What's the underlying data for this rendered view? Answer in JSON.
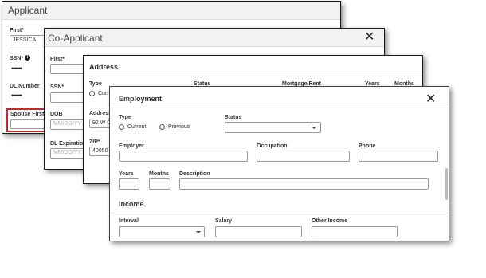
{
  "applicant": {
    "title": "Applicant",
    "first_label": "First*",
    "first_value": "JESSICA",
    "ssn_label": "SSN*",
    "ssn_dots": "••••••",
    "dl_number_label": "DL Number",
    "dl_dots": "••••••",
    "spouse_first_label": "Spouse First"
  },
  "coapplicant": {
    "title": "Co-Applicant",
    "first_label": "First*",
    "ssn_label": "SSN*",
    "dob_label": "DOB",
    "dob_placeholder": "MM/DD/YY",
    "dl_expiration_label": "DL Expiration",
    "dl_expiration_placeholder": "MM/DD/YY"
  },
  "address": {
    "title": "Address",
    "type_label": "Type",
    "type_option_current": "Curr",
    "status_label": "Status",
    "mortgage_label": "Mortgage/Rent",
    "years_label": "Years",
    "months_label": "Months",
    "address_label": "Address",
    "address_value": "92 W G",
    "zip_label": "ZIP*",
    "zip_value": "40050"
  },
  "employment": {
    "title": "Employment",
    "type_label": "Type",
    "type_options": [
      "Current",
      "Previous"
    ],
    "status_label": "Status",
    "employer_label": "Employer",
    "occupation_label": "Occupation",
    "phone_label": "Phone",
    "years_label": "Years",
    "months_label": "Months",
    "description_label": "Description",
    "income_heading": "Income",
    "interval_label": "Interval",
    "salary_label": "Salary",
    "other_income_label": "Other Income"
  },
  "icons": {
    "close": "close-icon",
    "info": "info-icon",
    "dropdown": "chevron-down-icon"
  },
  "colors": {
    "spouse_highlight": "#c62828",
    "header_bg": "#f2f2f2"
  }
}
